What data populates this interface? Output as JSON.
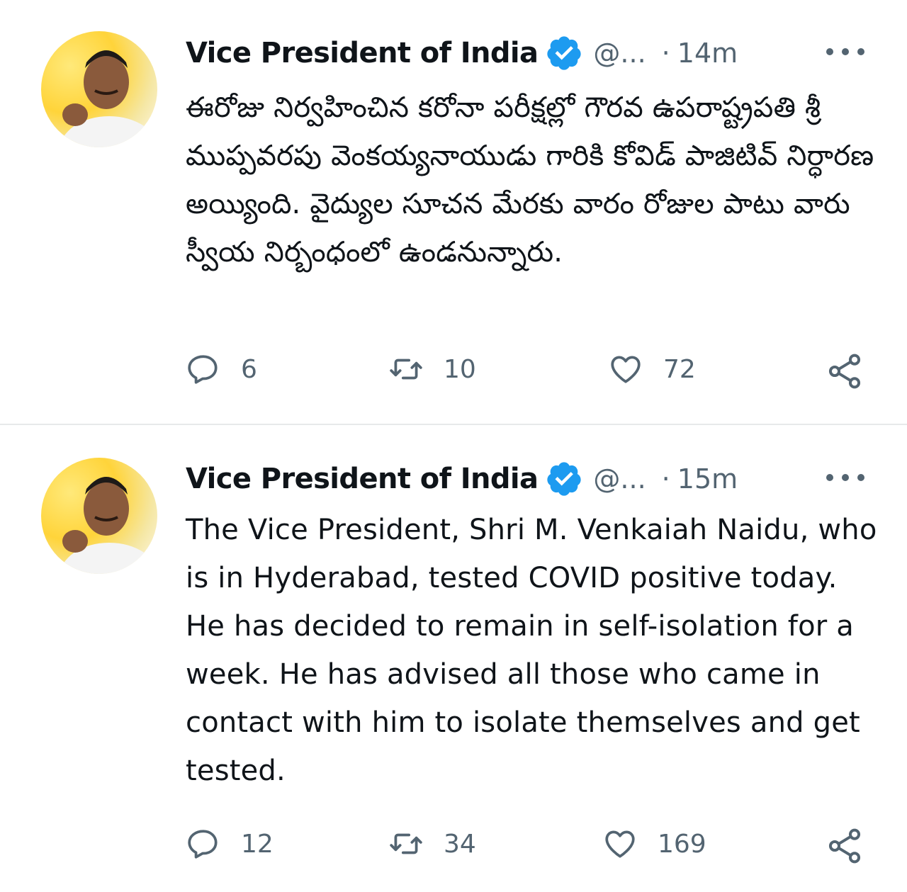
{
  "tweets": [
    {
      "author_name": "Vice President of India",
      "handle": "@...",
      "separator": "·",
      "time": "14m",
      "text": "ఈరోజు నిర్వహించిన కరోనా పరీక్షల్లో గౌరవ ఉపరాష్ట్రపతి శ్రీ ముప్పవరపు వెంకయ్యనాయుడు గారికి కోవిడ్ పాజిటివ్ నిర్ధారణ అయ్యింది. వైద్యుల సూచన మేరకు వారం రోజుల పాటు వారు స్వీయ నిర్బంధంలో ఉండనున్నారు.",
      "replies": "6",
      "retweets": "10",
      "likes": "72"
    },
    {
      "author_name": "Vice President of India",
      "handle": "@...",
      "separator": "·",
      "time": "15m",
      "text": "The Vice President, Shri M. Venkaiah Naidu, who is in Hyderabad, tested COVID positive today. He has decided to remain in self-isolation for a week. He has advised all those who came in contact with him to isolate themselves and get tested.",
      "replies": "12",
      "retweets": "34",
      "likes": "169"
    }
  ],
  "colors": {
    "text": "#0f1419",
    "secondary": "#536471",
    "verified": "#1d9bf0",
    "divider": "#e7e9ea"
  },
  "icons": {
    "reply": "reply-icon",
    "retweet": "retweet-icon",
    "like": "heart-icon",
    "share": "share-icon",
    "verified": "verified-badge-icon",
    "more": "more-icon"
  }
}
